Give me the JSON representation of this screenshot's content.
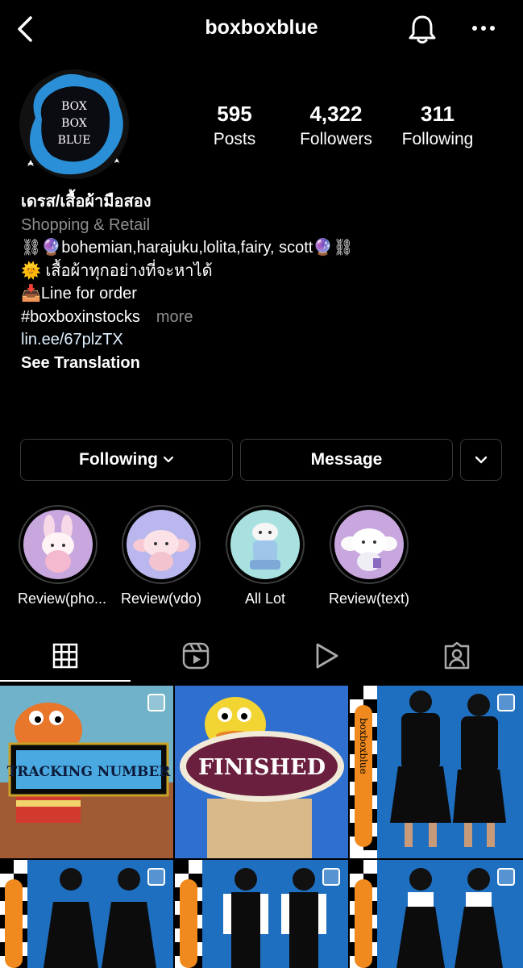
{
  "header": {
    "username": "boxboxblue"
  },
  "avatar": {
    "lines": [
      "BOX",
      "BOX",
      "BLUE"
    ]
  },
  "stats": {
    "posts": {
      "value": "595",
      "label": "Posts"
    },
    "followers": {
      "value": "4,322",
      "label": "Followers"
    },
    "following": {
      "value": "311",
      "label": "Following"
    }
  },
  "bio": {
    "name": "เดรส/เสื้อผ้ามือสอง",
    "category": "Shopping & Retail",
    "line1": "⛓🔮bohemian,harajuku,lolita,fairy, scott🔮⛓",
    "line2": "🌞 เสื้อผ้าทุกอย่างที่จะหาได้",
    "line3": "📥Line for order",
    "hashtag": "#boxboxinstocks",
    "more": "more",
    "link": "lin.ee/67plzTX",
    "translate": "See Translation"
  },
  "buttons": {
    "following": "Following",
    "message": "Message"
  },
  "highlights": [
    {
      "label": "Review(pho..."
    },
    {
      "label": "Review(vdo)"
    },
    {
      "label": "All Lot"
    },
    {
      "label": "Review(text)"
    }
  ],
  "grid": {
    "post1_text": "TRACKING NUMBER",
    "post2_text": "FINISHED",
    "side_strip_text": "boxboxblue"
  },
  "colors": {
    "background": "#000000",
    "muted": "#8e8e8e",
    "border": "#3a3a3a",
    "post_blue": "#1e6fc0"
  }
}
